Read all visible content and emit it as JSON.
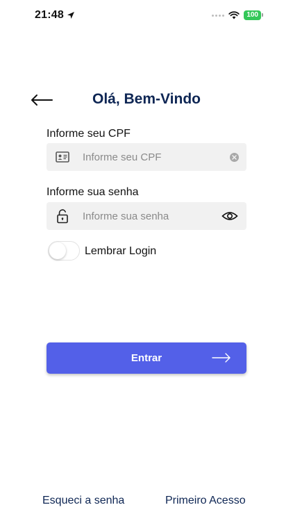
{
  "status_bar": {
    "time": "21:48",
    "battery": "100",
    "icons": [
      "location-arrow-icon",
      "signal-icon",
      "wifi-icon",
      "battery-icon"
    ]
  },
  "header": {
    "title": "Olá, Bem-Vindo",
    "back_icon": "back-arrow-icon"
  },
  "form": {
    "cpf": {
      "label": "Informe seu CPF",
      "placeholder": "Informe seu CPF",
      "value": "",
      "leading_icon": "id-card-icon",
      "trailing_icon": "clear-icon"
    },
    "password": {
      "label": "Informe sua senha",
      "placeholder": "Informe sua senha",
      "value": "",
      "leading_icon": "unlock-icon",
      "trailing_icon": "eye-icon"
    },
    "remember": {
      "label": "Lembrar Login",
      "enabled": false
    },
    "submit": {
      "label": "Entrar",
      "icon": "arrow-right-icon"
    }
  },
  "footer": {
    "forgot_password": "Esqueci a senha",
    "first_access": "Primeiro Acesso"
  },
  "colors": {
    "title": "#0e2654",
    "primary_button": "#5360e8",
    "field_background": "#f1f1f1",
    "battery": "#34c759"
  }
}
